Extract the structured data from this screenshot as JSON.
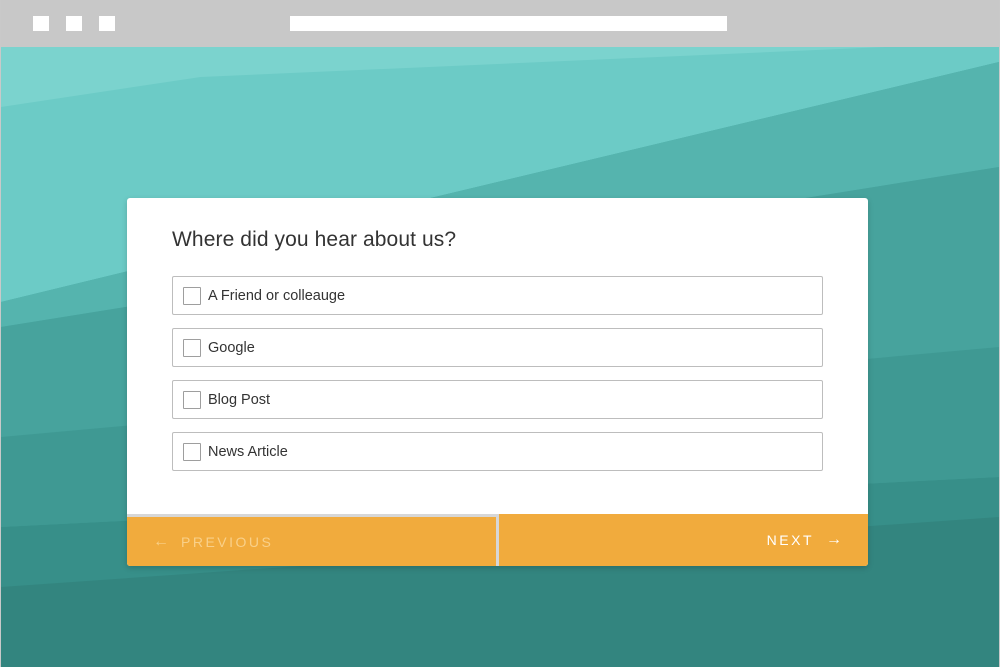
{
  "browser": {
    "window_control_icons": [
      "square-icon",
      "square-icon",
      "square-icon"
    ]
  },
  "survey": {
    "question": "Where did you hear about us?",
    "options": [
      {
        "label": "A Friend or colleauge",
        "checked": false
      },
      {
        "label": "Google",
        "checked": false
      },
      {
        "label": "Blog Post",
        "checked": false
      },
      {
        "label": "News Article",
        "checked": false
      }
    ],
    "previous_label": "PREVIOUS",
    "previous_icon": "arrow-left-icon",
    "next_label": "NEXT",
    "next_icon": "arrow-right-icon"
  },
  "colors": {
    "background_teal": "#4aa8a2",
    "button_orange": "#f1ab3d",
    "chrome_gray": "#c8c8c8"
  }
}
